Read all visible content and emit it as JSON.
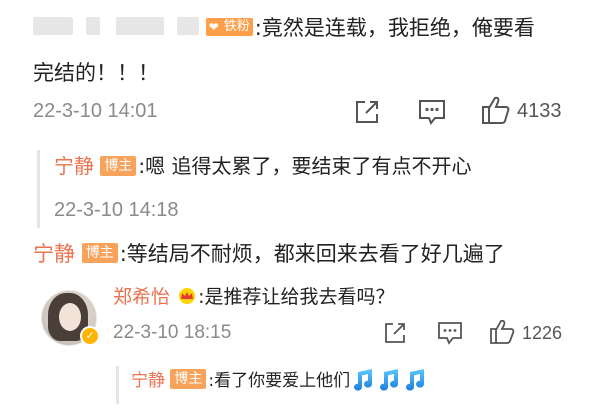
{
  "comment": {
    "badge": "铁粉",
    "text_line1": ":竟然是连载，我拒绝，俺要看",
    "text_line2": "完结的！！！",
    "time": "22-3-10 14:01",
    "like_count": "4133",
    "icons": [
      "share-icon",
      "comment-icon",
      "like-icon"
    ]
  },
  "reply1": {
    "author": "宁静",
    "badge": "博主",
    "text": ":嗯 追得太累了，要结束了有点不开心",
    "time": "22-3-10 14:18"
  },
  "reply2": {
    "author": "宁静",
    "badge": "博主",
    "text": ":等结局不耐烦，都来回来去看了好几遍了"
  },
  "subcomment": {
    "author": "郑希怡",
    "crown_icon": "crown-icon",
    "text": ":是推荐让给我去看吗？",
    "time": "22-3-10 18:15",
    "like_count": "1226",
    "verified_icon": "verified-icon"
  },
  "subreply": {
    "author": "宁静",
    "badge": "博主",
    "text": ":看了你要爱上他们",
    "emoji": [
      "music-note-icon",
      "music-note-icon",
      "music-note-icon"
    ]
  },
  "colors": {
    "accent": "#eb7350",
    "badge": "#f7a35c",
    "time": "#8a8a8a",
    "text": "#222222"
  }
}
